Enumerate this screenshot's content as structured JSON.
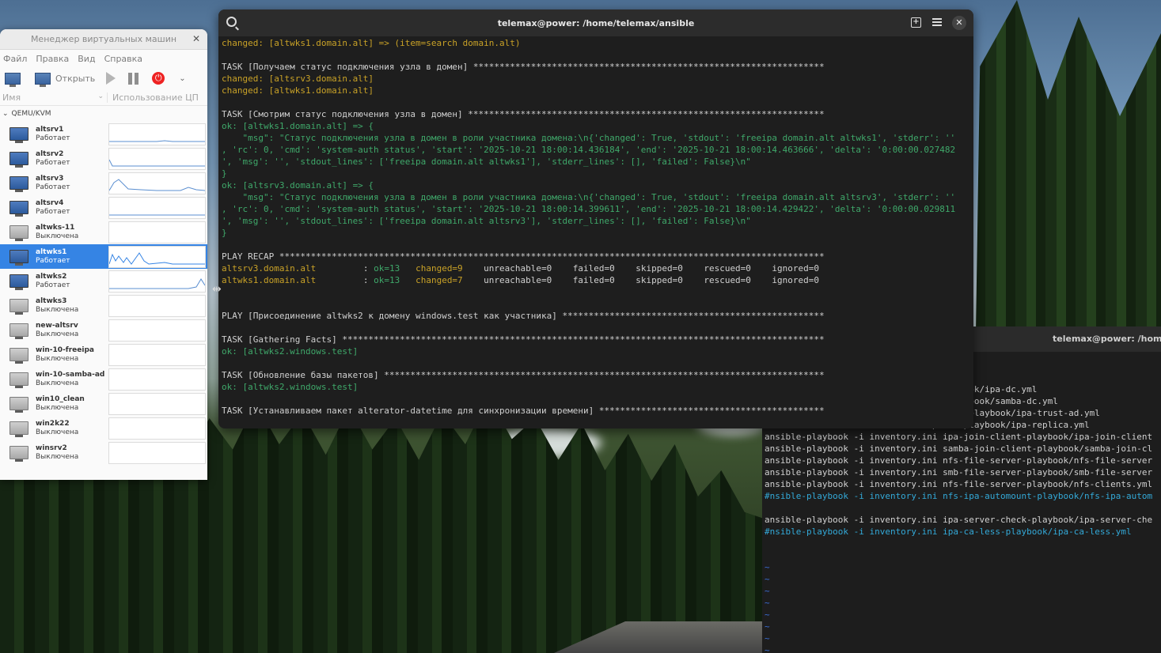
{
  "vm_manager": {
    "title": "Менеджер виртуальных машин",
    "menu": [
      "Файл",
      "Правка",
      "Вид",
      "Справка"
    ],
    "toolbar": {
      "open_label": "Открыть"
    },
    "columns": {
      "name": "Имя",
      "cpu": "Использование ЦП"
    },
    "group": "QEMU/KVM",
    "vms": [
      {
        "name": "altsrv1",
        "state": "Работает",
        "running": true
      },
      {
        "name": "altsrv2",
        "state": "Работает",
        "running": true
      },
      {
        "name": "altsrv3",
        "state": "Работает",
        "running": true
      },
      {
        "name": "altsrv4",
        "state": "Работает",
        "running": true
      },
      {
        "name": "altwks-11",
        "state": "Выключена",
        "running": false
      },
      {
        "name": "altwks1",
        "state": "Работает",
        "running": true,
        "selected": true
      },
      {
        "name": "altwks2",
        "state": "Работает",
        "running": true
      },
      {
        "name": "altwks3",
        "state": "Выключена",
        "running": false
      },
      {
        "name": "new-altsrv",
        "state": "Выключена",
        "running": false
      },
      {
        "name": "win-10-freeipa",
        "state": "Выключена",
        "running": false
      },
      {
        "name": "win-10-samba-ad",
        "state": "Выключена",
        "running": false
      },
      {
        "name": "win10_clean",
        "state": "Выключена",
        "running": false
      },
      {
        "name": "win2k22",
        "state": "Выключена",
        "running": false
      },
      {
        "name": "winsrv2",
        "state": "Выключена",
        "running": false
      }
    ]
  },
  "terminal": {
    "title": "telemax@power: /home/telemax/ansible",
    "lines": [
      {
        "segments": [
          {
            "t": "changed: [altwks1.domain.alt] => (item=search domain.alt)",
            "c": "yel"
          }
        ]
      },
      {
        "segments": []
      },
      {
        "segments": [
          {
            "t": "TASK [Получаем статус подключения узла в домен] *******************************************************************",
            "c": "wht"
          }
        ]
      },
      {
        "segments": [
          {
            "t": "changed: [altsrv3.domain.alt]",
            "c": "yel"
          }
        ]
      },
      {
        "segments": [
          {
            "t": "changed: [altwks1.domain.alt]",
            "c": "yel"
          }
        ]
      },
      {
        "segments": []
      },
      {
        "segments": [
          {
            "t": "TASK [Смотрим статус подключения узла в домен] ********************************************************************",
            "c": "wht"
          }
        ]
      },
      {
        "segments": [
          {
            "t": "ok: [altwks1.domain.alt] => {",
            "c": "grn"
          }
        ]
      },
      {
        "segments": [
          {
            "t": "    \"msg\": \"Статус подключения узла в домен в роли участника домена:\\n{'changed': True, 'stdout': 'freeipa domain.alt altwks1', 'stderr': ''",
            "c": "grn"
          }
        ]
      },
      {
        "segments": [
          {
            "t": ", 'rc': 0, 'cmd': 'system-auth status', 'start': '2025-10-21 18:00:14.436184', 'end': '2025-10-21 18:00:14.463666', 'delta': '0:00:00.027482",
            "c": "grn"
          }
        ]
      },
      {
        "segments": [
          {
            "t": "', 'msg': '', 'stdout_lines': ['freeipa domain.alt altwks1'], 'stderr_lines': [], 'failed': False}\\n\"",
            "c": "grn"
          }
        ]
      },
      {
        "segments": [
          {
            "t": "}",
            "c": "grn"
          }
        ]
      },
      {
        "segments": [
          {
            "t": "ok: [altsrv3.domain.alt] => {",
            "c": "grn"
          }
        ]
      },
      {
        "segments": [
          {
            "t": "    \"msg\": \"Статус подключения узла в домен в роли участника домена:\\n{'changed': True, 'stdout': 'freeipa domain.alt altsrv3', 'stderr': ''",
            "c": "grn"
          }
        ]
      },
      {
        "segments": [
          {
            "t": ", 'rc': 0, 'cmd': 'system-auth status', 'start': '2025-10-21 18:00:14.399611', 'end': '2025-10-21 18:00:14.429422', 'delta': '0:00:00.029811",
            "c": "grn"
          }
        ]
      },
      {
        "segments": [
          {
            "t": "', 'msg': '', 'stdout_lines': ['freeipa domain.alt altsrv3'], 'stderr_lines': [], 'failed': False}\\n\"",
            "c": "grn"
          }
        ]
      },
      {
        "segments": [
          {
            "t": "}",
            "c": "grn"
          }
        ]
      },
      {
        "segments": []
      },
      {
        "segments": [
          {
            "t": "PLAY RECAP ********************************************************************************************************",
            "c": "wht"
          }
        ]
      },
      {
        "segments": [
          {
            "t": "altsrv3.domain.alt",
            "c": "yel"
          },
          {
            "t": "         : ",
            "c": "wht"
          },
          {
            "t": "ok=13",
            "c": "grn"
          },
          {
            "t": "   ",
            "c": "wht"
          },
          {
            "t": "changed=9",
            "c": "yel"
          },
          {
            "t": "    unreachable=0    failed=0    skipped=0    rescued=0    ignored=0",
            "c": "wht"
          }
        ]
      },
      {
        "segments": [
          {
            "t": "altwks1.domain.alt",
            "c": "yel"
          },
          {
            "t": "         : ",
            "c": "wht"
          },
          {
            "t": "ok=13",
            "c": "grn"
          },
          {
            "t": "   ",
            "c": "wht"
          },
          {
            "t": "changed=7",
            "c": "yel"
          },
          {
            "t": "    unreachable=0    failed=0    skipped=0    rescued=0    ignored=0",
            "c": "wht"
          }
        ]
      },
      {
        "segments": []
      },
      {
        "segments": []
      },
      {
        "segments": [
          {
            "t": "PLAY [Присоединение altwks2 к домену windows.test как участника] **************************************************",
            "c": "wht"
          }
        ]
      },
      {
        "segments": []
      },
      {
        "segments": [
          {
            "t": "TASK [Gathering Facts] ********************************************************************************************",
            "c": "wht"
          }
        ]
      },
      {
        "segments": [
          {
            "t": "ok: [altwks2.windows.test]",
            "c": "grn"
          }
        ]
      },
      {
        "segments": []
      },
      {
        "segments": [
          {
            "t": "TASK [Обновление базы пакетов] ************************************************************************************",
            "c": "wht"
          }
        ]
      },
      {
        "segments": [
          {
            "t": "ok: [altwks2.windows.test]",
            "c": "grn"
          }
        ]
      },
      {
        "segments": []
      },
      {
        "segments": [
          {
            "t": "TASK [Устанавливаем пакет alterator-datetime для синхронизации времени] *******************************************",
            "c": "wht"
          }
        ]
      }
    ]
  },
  "terminal2": {
    "title": "telemax@power: /home/t",
    "lines": [
      {
        "segments": [
          {
            "t": "                               c-playbook/ipa-dc.yml",
            "c": "wht"
          }
        ]
      },
      {
        "segments": [
          {
            "t": "                               -dc-playbook/samba-dc.yml",
            "c": "wht"
          }
        ]
      },
      {
        "segments": [
          {
            "t": "                               rust-ad-playbook/ipa-trust-ad.yml",
            "c": "wht"
          }
        ]
      },
      {
        "segments": [
          {
            "t": "                               eplica-playbook/ipa-replica.yml",
            "c": "wht"
          }
        ]
      },
      {
        "segments": [
          {
            "t": "ansible-playbook -i inventory.ini ipa-join-client-playbook/ipa-join-client",
            "c": "wht"
          }
        ]
      },
      {
        "segments": [
          {
            "t": "ansible-playbook -i inventory.ini samba-join-client-playbook/samba-join-cl",
            "c": "wht"
          }
        ]
      },
      {
        "segments": [
          {
            "t": "ansible-playbook -i inventory.ini nfs-file-server-playbook/nfs-file-server",
            "c": "wht"
          }
        ]
      },
      {
        "segments": [
          {
            "t": "ansible-playbook -i inventory.ini smb-file-server-playbook/smb-file-server",
            "c": "wht"
          }
        ]
      },
      {
        "segments": [
          {
            "t": "ansible-playbook -i inventory.ini nfs-file-server-playbook/nfs-clients.yml",
            "c": "wht"
          }
        ]
      },
      {
        "segments": [
          {
            "t": "#nsible-playbook -i inventory.ini nfs-ipa-automount-playbook/nfs-ipa-autom",
            "c": "cyan"
          }
        ]
      },
      {
        "segments": []
      },
      {
        "segments": [
          {
            "t": "ansible-playbook -i inventory.ini ipa-server-check-playbook/ipa-server-che",
            "c": "wht"
          }
        ]
      },
      {
        "segments": [
          {
            "t": "#nsible-playbook -i inventory.ini ipa-ca-less-playbook/ipa-ca-less.yml",
            "c": "cyan"
          }
        ]
      },
      {
        "segments": []
      },
      {
        "segments": []
      },
      {
        "segments": [
          {
            "t": "~",
            "c": "tilde"
          }
        ]
      },
      {
        "segments": [
          {
            "t": "~",
            "c": "tilde"
          }
        ]
      },
      {
        "segments": [
          {
            "t": "~",
            "c": "tilde"
          }
        ]
      },
      {
        "segments": [
          {
            "t": "~",
            "c": "tilde"
          }
        ]
      },
      {
        "segments": [
          {
            "t": "~",
            "c": "tilde"
          }
        ]
      },
      {
        "segments": [
          {
            "t": "~",
            "c": "tilde"
          }
        ]
      },
      {
        "segments": [
          {
            "t": "~",
            "c": "tilde"
          }
        ]
      },
      {
        "segments": [
          {
            "t": "~",
            "c": "tilde"
          }
        ]
      }
    ]
  },
  "colors": {
    "selected": "#3584e4",
    "term_bg": "#1e1e1e",
    "term_yellow": "#c9a227",
    "term_green": "#3fa86a",
    "term_cyan": "#33a9d8"
  },
  "icons": [
    "search-icon",
    "new-tab-icon",
    "hamburger-menu-icon",
    "close-icon",
    "monitor-icon",
    "play-icon",
    "pause-icon",
    "power-icon"
  ]
}
